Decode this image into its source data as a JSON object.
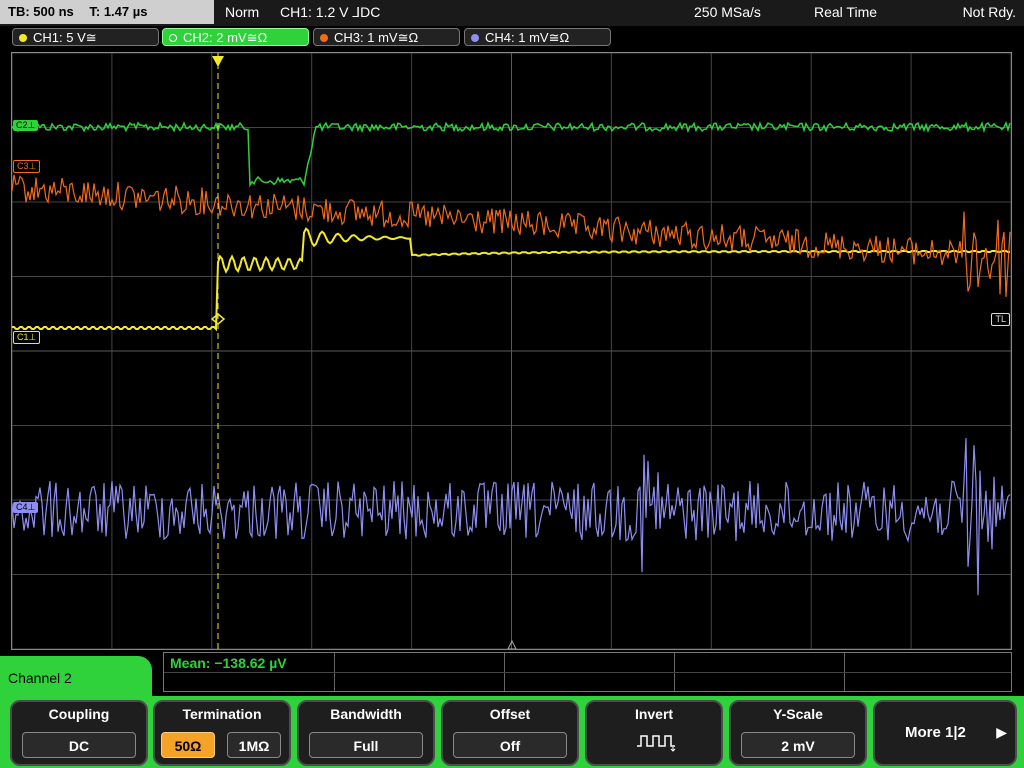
{
  "status": {
    "tb": "TB: 500 ns",
    "t": "T: 1.47 µs",
    "mode": "Norm",
    "trigger": "CH1: 1.2 V ⅃DC",
    "sample_rate": "250 MSa/s",
    "acq": "Real Time",
    "state": "Not Rdy."
  },
  "channels": [
    {
      "label": "CH1: 5 V≅",
      "color": "#f2e92c"
    },
    {
      "label": "CH2: 2 mV≅Ω",
      "color": "#2fd23a"
    },
    {
      "label": "CH3: 1 mV≅Ω",
      "color": "#f26b1d"
    },
    {
      "label": "CH4: 1 mV≅Ω",
      "color": "#8e8ef2"
    }
  ],
  "markers": {
    "c1": "C1⊥",
    "c2": "C2⊥",
    "c3": "C3⊥",
    "c4": "C4⊥",
    "tl": "TL"
  },
  "measurement": {
    "mean": "Mean: −138.62 µV"
  },
  "panel": {
    "title": "Channel 2"
  },
  "softkeys": {
    "coupling": {
      "title": "Coupling",
      "value": "DC"
    },
    "termination": {
      "title": "Termination",
      "opt1": "50Ω",
      "opt2": "1MΩ"
    },
    "bandwidth": {
      "title": "Bandwidth",
      "value": "Full"
    },
    "offset": {
      "title": "Offset",
      "value": "Off"
    },
    "invert": {
      "title": "Invert"
    },
    "yscale": {
      "title": "Y-Scale",
      "value": "2 mV"
    },
    "more": {
      "label": "More 1|2"
    }
  }
}
